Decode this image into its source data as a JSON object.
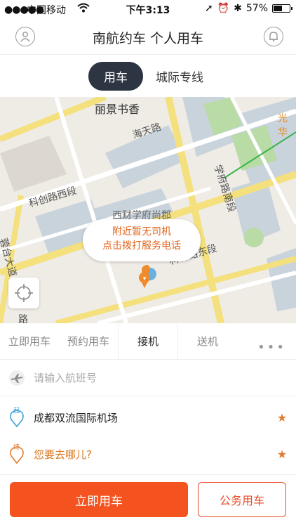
{
  "status": {
    "carrier": "中国移动",
    "time": "下午3:13",
    "battery": "57%",
    "battery_level": 0.57
  },
  "header": {
    "title": "南航约车 个人用车"
  },
  "tabs": [
    {
      "label": "用车"
    },
    {
      "label": "城际专线"
    }
  ],
  "map": {
    "labels": [
      "丽景书香",
      "海天路",
      "科创路西段",
      "学府路南段",
      "西财学府尚郡",
      "科林路东段",
      "光华",
      "蓉台大道",
      "路"
    ],
    "tooltip_line1": "附近暂无司机",
    "tooltip_line2": "点击拨打服务电话"
  },
  "subtabs": [
    {
      "label": "立即用车"
    },
    {
      "label": "预约用车"
    },
    {
      "label": "接机"
    },
    {
      "label": "送机"
    }
  ],
  "form": {
    "flight_placeholder": "请输入航班号",
    "start_badge": "起",
    "start": "成都双流国际机场",
    "end_badge": "终",
    "destination": "您要去哪儿?"
  },
  "buttons": {
    "primary": "立即用车",
    "secondary": "公务用车"
  },
  "colors": {
    "accent": "#f4521f",
    "dark_tab": "#2d3542",
    "text_orange": "#e2661e"
  }
}
